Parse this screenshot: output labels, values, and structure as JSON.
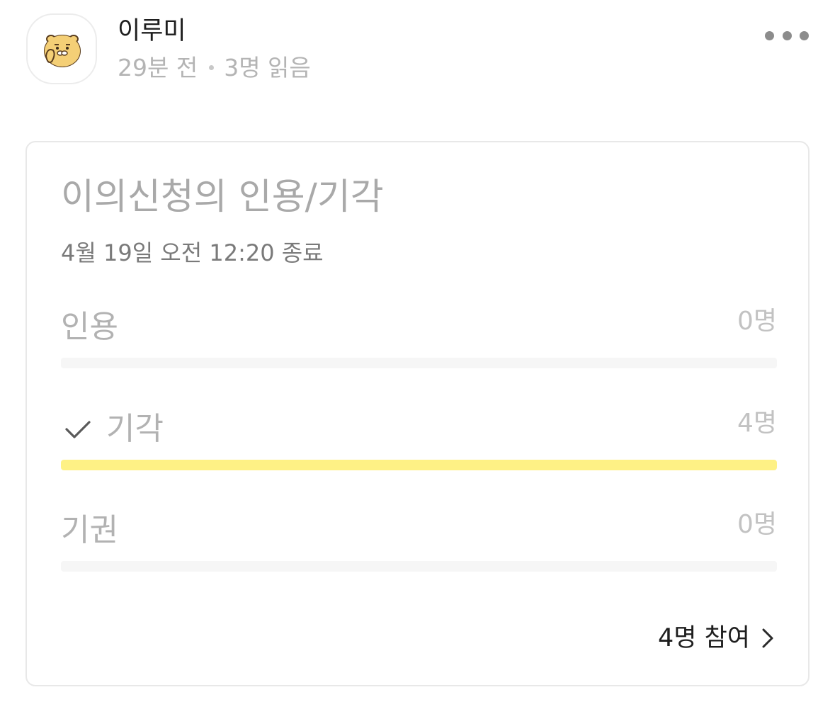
{
  "post": {
    "author": "이루미",
    "time": "29분 전",
    "readers": "3명 읽음"
  },
  "poll": {
    "title": "이의신청의 인용/기각",
    "deadline": "4월 19일 오전 12:20 종료",
    "options": [
      {
        "label": "인용",
        "count": "0명",
        "fraction": 0,
        "selected": false
      },
      {
        "label": "기각",
        "count": "4명",
        "fraction": 1,
        "selected": true
      },
      {
        "label": "기권",
        "count": "0명",
        "fraction": 0,
        "selected": false
      }
    ],
    "participants": "4명 참여"
  },
  "colors": {
    "bar_fill": "#fef185",
    "bar_track": "#f6f6f6"
  },
  "icons": {
    "avatar": "ryan-character-icon",
    "menu": "more-dots-icon",
    "selected": "check-icon",
    "chevron": "chevron-right-icon"
  }
}
